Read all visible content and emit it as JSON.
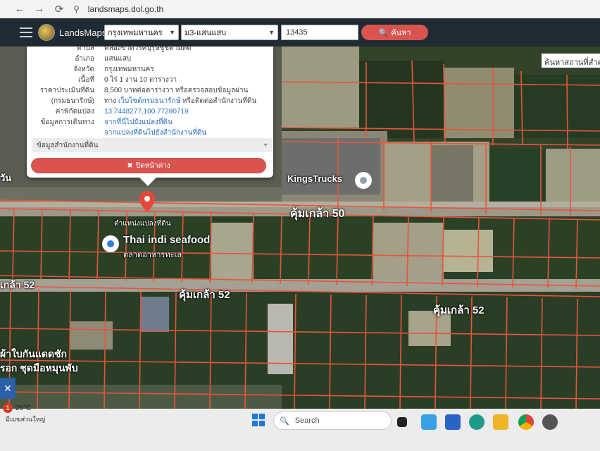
{
  "browser": {
    "url": "landsmaps.dol.go.th",
    "back_icon": "arrow-left-icon",
    "forward_icon": "arrow-right-icon",
    "refresh_icon": "refresh-icon"
  },
  "header": {
    "app_title": "LandsMaps",
    "province": "กรุงเทพมหานคร",
    "district": "ม3-แสนแสบ",
    "parcel_no": "13435",
    "search_label": "ค้นหา"
  },
  "popup": {
    "rows": [
      {
        "key": "ตำบล",
        "value": "คลองขวดวรคบุรุษชูชตามตัด"
      },
      {
        "key": "อำเภอ",
        "value": "แสนแสบ"
      },
      {
        "key": "จังหวัด",
        "value": "กรุงเทพมหานคร"
      },
      {
        "key": "เนื้อที่",
        "value": "0 ไร่ 1 งาน 10 ตารางวา"
      },
      {
        "key": "ราคาประเมินที่ดิน",
        "value": "8,500 บาทต่อตารางวา หรือตรวจสอบข้อมูลผ่าน"
      },
      {
        "key": "(กรมธนารักษ์)",
        "value_prefix": "ทาง ",
        "value_link": "เว็บไซต์กรมธนารักษ์",
        "value_suffix": " หรือติดต่อสำนักงานที่ดิน"
      },
      {
        "key": "ค่าพิกัดแปลง",
        "value_link": "13.7448277,100.77280719"
      },
      {
        "key": "ข้อมูลการเดินทาง",
        "value_link": "จากที่นี่ไปยังแปลงที่ดิน"
      },
      {
        "key": "",
        "value_link": "จากแปลงที่ดินไปยังสำนักงานที่ดิน"
      }
    ],
    "office_section": "ข้อมูลสำนักงานที่ดิน",
    "office_expand": "+",
    "close_label": "ปิดหน้าต่าง"
  },
  "map": {
    "search_places": "ค้นหาสถานที่สำคัญ",
    "labels": {
      "road_50": "คุ้มเกล้า 50",
      "road_52_left": "คุ้มเกล้า 52",
      "road_52_right": "คุ้มเกล้า 52",
      "road_52_edge": "เกล้า 52",
      "kings_trucks": "KingsTrucks",
      "thai_indi": "Thai indi seafood",
      "thai_indi_sub": "ตลาดอาหารทะเล",
      "parcel_position": "ตำแหน่งแปลงที่ดิน",
      "left_edge": "วัน",
      "bottom_left_1": "ผ้าใบกันแดดชัก",
      "bottom_left_2": "รอก ชุดมือหมุนพับ"
    }
  },
  "taskbar": {
    "temperature": "26°C",
    "weather_text": "มีเมฆส่วนใหญ่",
    "weather_badge": "1",
    "search_label": "Search",
    "icons": [
      "windows-start-icon",
      "search-icon",
      "task-view-icon",
      "photos-icon",
      "store-icon",
      "edge-icon",
      "file-explorer-icon",
      "chrome-icon",
      "settings-icon"
    ]
  },
  "colors": {
    "header_bg": "#1f2a33",
    "accent_red": "#d9534f",
    "parcel_line": "#e8553a",
    "link_blue": "#2a6fc4"
  }
}
